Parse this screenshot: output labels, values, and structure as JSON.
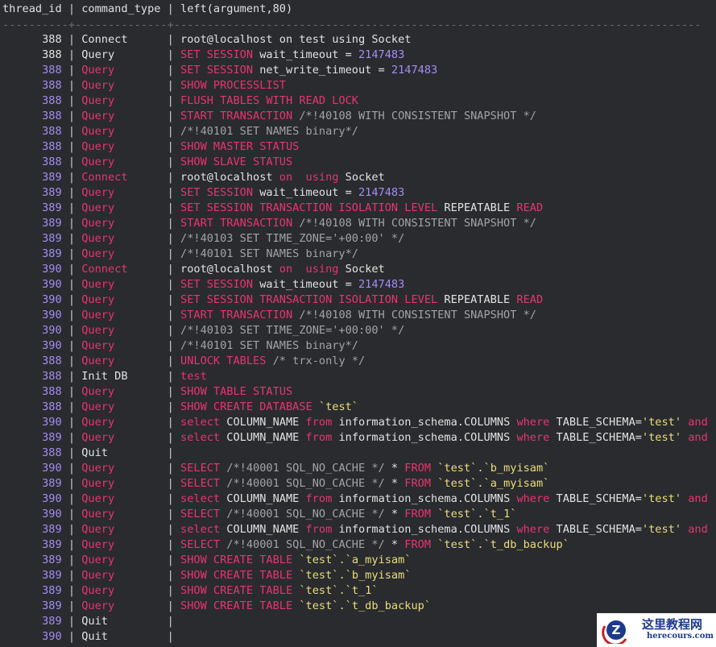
{
  "header": {
    "col1": "thread_id",
    "col2": "command_type",
    "col3": "left(argument,80)"
  },
  "separator": "----------+--------------+--------------------------------------------------------------------------------",
  "colors": {
    "keyword": "#e8346f",
    "text": "#e2e2e2",
    "comment": "#a3a3a6",
    "string": "#e9dd7a",
    "number": "#a58cf2"
  },
  "rows": [
    {
      "id": "388",
      "cmd": "Connect",
      "plain": true,
      "arg": [
        [
          "t",
          "root@localhost on test using Socket"
        ]
      ]
    },
    {
      "id": "388",
      "cmd": "Query",
      "plain": true,
      "arg": [
        [
          "k",
          "SET SESSION"
        ],
        [
          "t",
          " wait_timeout = "
        ],
        [
          "n",
          "2147483"
        ]
      ]
    },
    {
      "id": "388",
      "cmd": "Query",
      "arg": [
        [
          "k",
          "SET SESSION"
        ],
        [
          "t",
          " net_write_timeout = "
        ],
        [
          "n",
          "2147483"
        ]
      ]
    },
    {
      "id": "388",
      "cmd": "Query",
      "arg": [
        [
          "k",
          "SHOW PROCESSLIST"
        ]
      ]
    },
    {
      "id": "388",
      "cmd": "Query",
      "arg": [
        [
          "k",
          "FLUSH TABLES WITH READ LOCK"
        ]
      ]
    },
    {
      "id": "388",
      "cmd": "Query",
      "arg": [
        [
          "k",
          "START TRANSACTION"
        ],
        [
          "c",
          " /*!40108 WITH CONSISTENT SNAPSHOT */"
        ]
      ]
    },
    {
      "id": "388",
      "cmd": "Query",
      "arg": [
        [
          "c",
          "/*!40101 SET NAMES binary*/"
        ]
      ]
    },
    {
      "id": "388",
      "cmd": "Query",
      "arg": [
        [
          "k",
          "SHOW MASTER STATUS"
        ]
      ]
    },
    {
      "id": "388",
      "cmd": "Query",
      "arg": [
        [
          "k",
          "SHOW SLAVE STATUS"
        ]
      ]
    },
    {
      "id": "389",
      "cmd": "Connect",
      "arg": [
        [
          "t",
          "root@localhost "
        ],
        [
          "k",
          "on"
        ],
        [
          "t",
          "  "
        ],
        [
          "k",
          "using"
        ],
        [
          "t",
          " Socket"
        ]
      ]
    },
    {
      "id": "389",
      "cmd": "Query",
      "arg": [
        [
          "k",
          "SET SESSION"
        ],
        [
          "t",
          " wait_timeout = "
        ],
        [
          "n",
          "2147483"
        ]
      ]
    },
    {
      "id": "389",
      "cmd": "Query",
      "arg": [
        [
          "k",
          "SET SESSION TRANSACTION ISOLATION LEVEL"
        ],
        [
          "t",
          " REPEATABLE "
        ],
        [
          "k",
          "READ"
        ]
      ]
    },
    {
      "id": "389",
      "cmd": "Query",
      "arg": [
        [
          "k",
          "START TRANSACTION"
        ],
        [
          "c",
          " /*!40108 WITH CONSISTENT SNAPSHOT */"
        ]
      ]
    },
    {
      "id": "389",
      "cmd": "Query",
      "arg": [
        [
          "c",
          "/*!40103 SET TIME_ZONE='+00:00' */"
        ]
      ]
    },
    {
      "id": "389",
      "cmd": "Query",
      "arg": [
        [
          "c",
          "/*!40101 SET NAMES binary*/"
        ]
      ]
    },
    {
      "id": "390",
      "cmd": "Connect",
      "arg": [
        [
          "t",
          "root@localhost "
        ],
        [
          "k",
          "on"
        ],
        [
          "t",
          "  "
        ],
        [
          "k",
          "using"
        ],
        [
          "t",
          " Socket"
        ]
      ]
    },
    {
      "id": "390",
      "cmd": "Query",
      "arg": [
        [
          "k",
          "SET SESSION"
        ],
        [
          "t",
          " wait_timeout = "
        ],
        [
          "n",
          "2147483"
        ]
      ]
    },
    {
      "id": "390",
      "cmd": "Query",
      "arg": [
        [
          "k",
          "SET SESSION TRANSACTION ISOLATION LEVEL"
        ],
        [
          "t",
          " REPEATABLE "
        ],
        [
          "k",
          "READ"
        ]
      ]
    },
    {
      "id": "390",
      "cmd": "Query",
      "arg": [
        [
          "k",
          "START TRANSACTION"
        ],
        [
          "c",
          " /*!40108 WITH CONSISTENT SNAPSHOT */"
        ]
      ]
    },
    {
      "id": "390",
      "cmd": "Query",
      "arg": [
        [
          "c",
          "/*!40103 SET TIME_ZONE='+00:00' */"
        ]
      ]
    },
    {
      "id": "390",
      "cmd": "Query",
      "arg": [
        [
          "c",
          "/*!40101 SET NAMES binary*/"
        ]
      ]
    },
    {
      "id": "388",
      "cmd": "Query",
      "arg": [
        [
          "k",
          "UNLOCK TABLES"
        ],
        [
          "c",
          " /* trx-only */"
        ]
      ]
    },
    {
      "id": "388",
      "cmd": "Init DB",
      "cmdPlain": true,
      "arg": [
        [
          "k",
          "test"
        ]
      ]
    },
    {
      "id": "388",
      "cmd": "Query",
      "arg": [
        [
          "k",
          "SHOW TABLE STATUS"
        ]
      ]
    },
    {
      "id": "388",
      "cmd": "Query",
      "arg": [
        [
          "k",
          "SHOW CREATE DATABASE"
        ],
        [
          "s",
          " `test`"
        ]
      ]
    },
    {
      "id": "390",
      "cmd": "Query",
      "arg": [
        [
          "k",
          "select"
        ],
        [
          "t",
          " COLUMN_NAME "
        ],
        [
          "k",
          "from"
        ],
        [
          "t",
          " information_schema.COLUMNS "
        ],
        [
          "k",
          "where"
        ],
        [
          "t",
          " TABLE_SCHEMA="
        ],
        [
          "s",
          "'test'"
        ],
        [
          "t",
          " "
        ],
        [
          "k",
          "and"
        ]
      ]
    },
    {
      "id": "389",
      "cmd": "Query",
      "arg": [
        [
          "k",
          "select"
        ],
        [
          "t",
          " COLUMN_NAME "
        ],
        [
          "k",
          "from"
        ],
        [
          "t",
          " information_schema.COLUMNS "
        ],
        [
          "k",
          "where"
        ],
        [
          "t",
          " TABLE_SCHEMA="
        ],
        [
          "s",
          "'test'"
        ],
        [
          "t",
          " "
        ],
        [
          "k",
          "and"
        ]
      ]
    },
    {
      "id": "388",
      "cmd": "Quit",
      "cmdPlain": true,
      "arg": []
    },
    {
      "id": "390",
      "cmd": "Query",
      "arg": [
        [
          "k",
          "SELECT"
        ],
        [
          "c",
          " /*!40001 SQL_NO_CACHE */ "
        ],
        [
          "t",
          "* "
        ],
        [
          "k",
          "FROM"
        ],
        [
          "s",
          " `test`.`b_myisam`"
        ]
      ]
    },
    {
      "id": "389",
      "cmd": "Query",
      "arg": [
        [
          "k",
          "SELECT"
        ],
        [
          "c",
          " /*!40001 SQL_NO_CACHE */ "
        ],
        [
          "t",
          "* "
        ],
        [
          "k",
          "FROM"
        ],
        [
          "s",
          " `test`.`a_myisam`"
        ]
      ]
    },
    {
      "id": "390",
      "cmd": "Query",
      "arg": [
        [
          "k",
          "select"
        ],
        [
          "t",
          " COLUMN_NAME "
        ],
        [
          "k",
          "from"
        ],
        [
          "t",
          " information_schema.COLUMNS "
        ],
        [
          "k",
          "where"
        ],
        [
          "t",
          " TABLE_SCHEMA="
        ],
        [
          "s",
          "'test'"
        ],
        [
          "t",
          " "
        ],
        [
          "k",
          "and"
        ]
      ]
    },
    {
      "id": "390",
      "cmd": "Query",
      "arg": [
        [
          "k",
          "SELECT"
        ],
        [
          "c",
          " /*!40001 SQL_NO_CACHE */ "
        ],
        [
          "t",
          "* "
        ],
        [
          "k",
          "FROM"
        ],
        [
          "s",
          " `test`.`t_1`"
        ]
      ]
    },
    {
      "id": "389",
      "cmd": "Query",
      "arg": [
        [
          "k",
          "select"
        ],
        [
          "t",
          " COLUMN_NAME "
        ],
        [
          "k",
          "from"
        ],
        [
          "t",
          " information_schema.COLUMNS "
        ],
        [
          "k",
          "where"
        ],
        [
          "t",
          " TABLE_SCHEMA="
        ],
        [
          "s",
          "'test'"
        ],
        [
          "t",
          " "
        ],
        [
          "k",
          "and"
        ]
      ]
    },
    {
      "id": "389",
      "cmd": "Query",
      "arg": [
        [
          "k",
          "SELECT"
        ],
        [
          "c",
          " /*!40001 SQL_NO_CACHE */ "
        ],
        [
          "t",
          "* "
        ],
        [
          "k",
          "FROM"
        ],
        [
          "s",
          " `test`.`t_db_backup`"
        ]
      ]
    },
    {
      "id": "389",
      "cmd": "Query",
      "arg": [
        [
          "k",
          "SHOW CREATE TABLE"
        ],
        [
          "s",
          " `test`.`a_myisam`"
        ]
      ]
    },
    {
      "id": "389",
      "cmd": "Query",
      "arg": [
        [
          "k",
          "SHOW CREATE TABLE"
        ],
        [
          "s",
          " `test`.`b_myisam`"
        ]
      ]
    },
    {
      "id": "389",
      "cmd": "Query",
      "arg": [
        [
          "k",
          "SHOW CREATE TABLE"
        ],
        [
          "s",
          " `test`.`t_1`"
        ]
      ]
    },
    {
      "id": "389",
      "cmd": "Query",
      "arg": [
        [
          "k",
          "SHOW CREATE TABLE"
        ],
        [
          "s",
          " `test`.`t_db_backup`"
        ]
      ]
    },
    {
      "id": "389",
      "cmd": "Quit",
      "cmdPlain": true,
      "arg": []
    },
    {
      "id": "390",
      "cmd": "Quit",
      "cmdPlain": true,
      "arg": []
    }
  ],
  "watermark": {
    "title": "这里教程网",
    "site": "herecours.com",
    "logo_letter": "Z"
  }
}
